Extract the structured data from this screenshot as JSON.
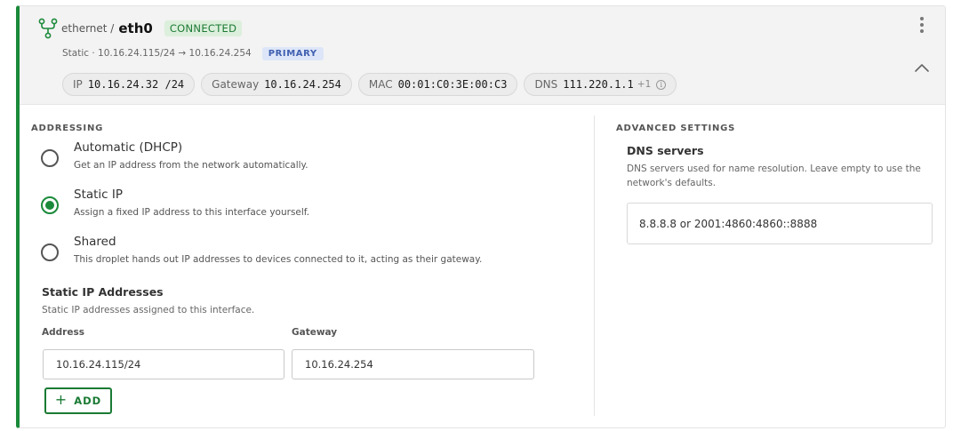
{
  "header": {
    "interface_type": "ethernet /",
    "interface_name": "eth0",
    "status": "CONNECTED",
    "summary": "Static · 10.16.24.115/24 → 10.16.24.254",
    "role_badge": "PRIMARY",
    "chips": {
      "ip_label": "IP",
      "ip_value": "10.16.24.32 /24",
      "gateway_label": "Gateway",
      "gateway_value": "10.16.24.254",
      "mac_label": "MAC",
      "mac_value": "00:01:C0:3E:00:C3",
      "dns_label": "DNS",
      "dns_value": "111.220.1.1",
      "dns_extra": "+1"
    }
  },
  "addressing": {
    "title": "ADDRESSING",
    "options": [
      {
        "label": "Automatic (DHCP)",
        "description": "Get an IP address from the network automatically.",
        "checked": false
      },
      {
        "label": "Static IP",
        "description": "Assign a fixed IP address to this interface yourself.",
        "checked": true
      },
      {
        "label": "Shared",
        "description": "This droplet hands out IP addresses to devices connected to it, acting as their gateway.",
        "checked": false
      }
    ],
    "static_title": "Static IP Addresses",
    "static_description": "Static IP addresses assigned to this interface.",
    "address_label": "Address",
    "gateway_label": "Gateway",
    "address_value": "10.16.24.115/24",
    "gateway_value": "10.16.24.254",
    "add_label": "ADD"
  },
  "advanced": {
    "title": "ADVANCED SETTINGS",
    "dns_title": "DNS servers",
    "dns_description_line1": "DNS servers used for name resolution. Leave empty to use the",
    "dns_description_line2": "network's defaults.",
    "dns_placeholder": "8.8.8.8 or 2001:4860:4860::8888"
  },
  "colors": {
    "accent": "#1a8a3a",
    "connected_bg": "#dcefdc",
    "primary_bg": "#dde6f8"
  },
  "icons": {
    "interface": "network-fork-icon",
    "menu": "kebab-menu-icon",
    "collapse": "chevron-up-icon",
    "info": "info-icon",
    "add": "plus-icon"
  }
}
